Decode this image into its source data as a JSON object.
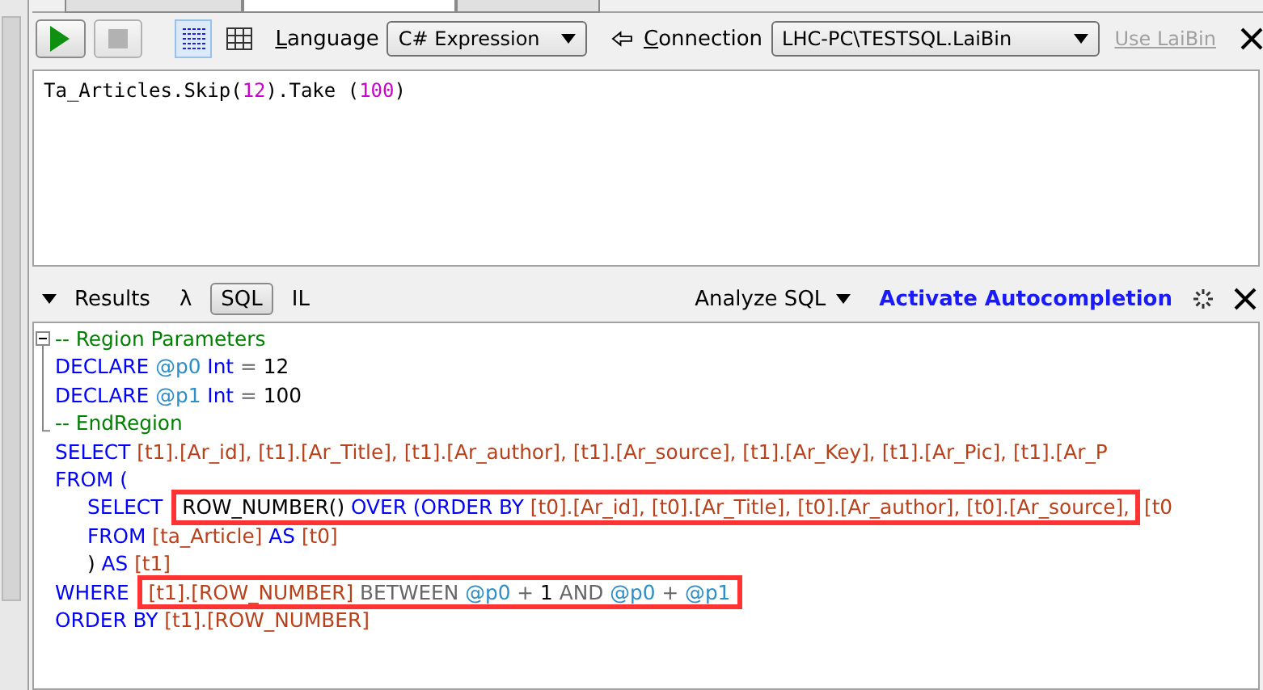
{
  "query_tabs": [
    {
      "selected": false
    },
    {
      "selected": true
    },
    {
      "selected": false
    }
  ],
  "toolbar": {
    "run_button": {
      "disabled": false
    },
    "stop_button": {
      "disabled": true
    },
    "view_toggles": [
      {
        "kind": "text",
        "selected": true
      },
      {
        "kind": "grid",
        "selected": false
      }
    ],
    "language": {
      "label": "Language",
      "value": "C# Expression"
    },
    "connection": {
      "label": "Connection",
      "value": "LHC-PC\\TESTSQL.LaiBin"
    },
    "use_link": {
      "text": "Use LaiBin",
      "disabled": true
    }
  },
  "query_editor": {
    "tokens": [
      {
        "kind": "plain",
        "text": "Ta_Articles.Skip("
      },
      {
        "kind": "number",
        "text": "12"
      },
      {
        "kind": "plain",
        "text": ").Take ("
      },
      {
        "kind": "number",
        "text": "100"
      },
      {
        "kind": "plain",
        "text": ")"
      }
    ]
  },
  "results_bar": {
    "tabs": [
      {
        "label": "Results",
        "selected": false
      },
      {
        "label": "λ",
        "selected": false
      },
      {
        "label": "SQL",
        "selected": true
      },
      {
        "label": "IL",
        "selected": false
      }
    ],
    "analyze": "Analyze SQL",
    "autocompletion": "Activate Autocompletion"
  },
  "sql_pane": {
    "blocks": [
      {
        "kind": "region",
        "expanded": true,
        "lines": [
          {
            "indented": false,
            "segments": [
              {
                "highlighted": false,
                "tokens": [
                  {
                    "kind": "comment",
                    "text": "-- Region Parameters"
                  }
                ]
              }
            ]
          },
          {
            "indented": false,
            "segments": [
              {
                "highlighted": false,
                "tokens": [
                  {
                    "kind": "keyword",
                    "text": "DECLARE"
                  },
                  {
                    "kind": "param",
                    "text": "@p0"
                  },
                  {
                    "kind": "keyword",
                    "text": "Int"
                  },
                  {
                    "kind": "op",
                    "text": "="
                  },
                  {
                    "kind": "number",
                    "text": "12"
                  }
                ]
              }
            ]
          },
          {
            "indented": false,
            "segments": [
              {
                "highlighted": false,
                "tokens": [
                  {
                    "kind": "keyword",
                    "text": "DECLARE"
                  },
                  {
                    "kind": "param",
                    "text": "@p1"
                  },
                  {
                    "kind": "keyword",
                    "text": "Int"
                  },
                  {
                    "kind": "op",
                    "text": "="
                  },
                  {
                    "kind": "number",
                    "text": "100"
                  }
                ]
              }
            ]
          },
          {
            "indented": false,
            "segments": [
              {
                "highlighted": false,
                "tokens": [
                  {
                    "kind": "comment",
                    "text": "-- EndRegion"
                  }
                ]
              }
            ]
          }
        ]
      },
      {
        "kind": "code",
        "lines": [
          {
            "indented": false,
            "segments": [
              {
                "highlighted": false,
                "tokens": [
                  {
                    "kind": "keyword",
                    "text": "SELECT"
                  },
                  {
                    "kind": "ident",
                    "text": "[t1].[Ar_id],"
                  },
                  {
                    "kind": "ident",
                    "text": "[t1].[Ar_Title],"
                  },
                  {
                    "kind": "ident",
                    "text": "[t1].[Ar_author],"
                  },
                  {
                    "kind": "ident",
                    "text": "[t1].[Ar_source],"
                  },
                  {
                    "kind": "ident",
                    "text": "[t1].[Ar_Key],"
                  },
                  {
                    "kind": "ident",
                    "text": "[t1].[Ar_Pic],"
                  },
                  {
                    "kind": "ident",
                    "text": "[t1].[Ar_P"
                  }
                ]
              }
            ]
          },
          {
            "indented": false,
            "segments": [
              {
                "highlighted": false,
                "tokens": [
                  {
                    "kind": "keyword",
                    "text": "FROM ("
                  }
                ]
              }
            ]
          },
          {
            "indented": true,
            "segments": [
              {
                "highlighted": false,
                "tokens": [
                  {
                    "kind": "keyword",
                    "text": "SELECT"
                  }
                ]
              },
              {
                "highlighted": true,
                "tokens": [
                  {
                    "kind": "plain",
                    "text": "ROW_NUMBER()"
                  },
                  {
                    "kind": "keyword",
                    "text": "OVER (ORDER BY"
                  },
                  {
                    "kind": "ident",
                    "text": "[t0].[Ar_id],"
                  },
                  {
                    "kind": "ident",
                    "text": "[t0].[Ar_Title],"
                  },
                  {
                    "kind": "ident",
                    "text": "[t0].[Ar_author],"
                  },
                  {
                    "kind": "ident",
                    "text": "[t0].[Ar_source],"
                  }
                ]
              },
              {
                "highlighted": false,
                "tokens": [
                  {
                    "kind": "ident",
                    "text": "[t0"
                  }
                ]
              }
            ]
          },
          {
            "indented": true,
            "segments": [
              {
                "highlighted": false,
                "tokens": [
                  {
                    "kind": "keyword",
                    "text": "FROM"
                  },
                  {
                    "kind": "ident",
                    "text": "[ta_Article]"
                  },
                  {
                    "kind": "keyword",
                    "text": "AS"
                  },
                  {
                    "kind": "ident",
                    "text": "[t0]"
                  }
                ]
              }
            ]
          },
          {
            "indented": true,
            "segments": [
              {
                "highlighted": false,
                "tokens": [
                  {
                    "kind": "plain",
                    "text": ")"
                  },
                  {
                    "kind": "keyword",
                    "text": "AS"
                  },
                  {
                    "kind": "ident",
                    "text": "[t1]"
                  }
                ]
              }
            ]
          },
          {
            "indented": false,
            "segments": [
              {
                "highlighted": false,
                "tokens": [
                  {
                    "kind": "keyword",
                    "text": "WHERE"
                  }
                ]
              },
              {
                "highlighted": true,
                "tokens": [
                  {
                    "kind": "ident",
                    "text": "[t1].[ROW_NUMBER]"
                  },
                  {
                    "kind": "op",
                    "text": "BETWEEN"
                  },
                  {
                    "kind": "param",
                    "text": "@p0"
                  },
                  {
                    "kind": "op",
                    "text": "+"
                  },
                  {
                    "kind": "number",
                    "text": "1"
                  },
                  {
                    "kind": "op",
                    "text": "AND"
                  },
                  {
                    "kind": "param",
                    "text": "@p0"
                  },
                  {
                    "kind": "op",
                    "text": "+"
                  },
                  {
                    "kind": "param",
                    "text": "@p1"
                  }
                ]
              }
            ]
          },
          {
            "indented": false,
            "segments": [
              {
                "highlighted": false,
                "tokens": [
                  {
                    "kind": "keyword",
                    "text": "ORDER BY"
                  },
                  {
                    "kind": "ident",
                    "text": "[t1].[ROW_NUMBER]"
                  }
                ]
              }
            ]
          }
        ]
      }
    ]
  }
}
